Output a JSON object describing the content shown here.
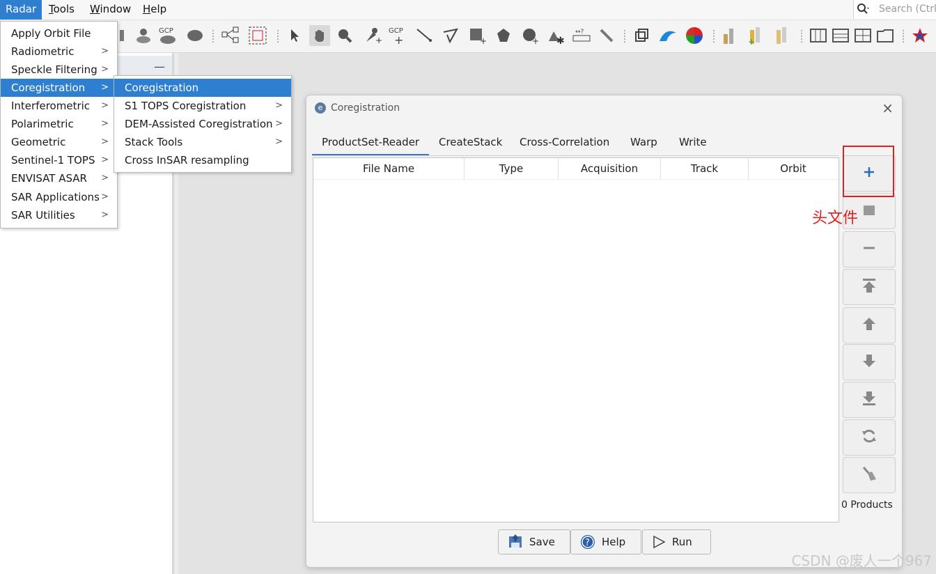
{
  "menubar": {
    "items": [
      {
        "label": "Radar",
        "ul": "",
        "rest": "Radar"
      },
      {
        "label": "Tools",
        "ul": "T",
        "rest": "ools"
      },
      {
        "label": "Window",
        "ul": "W",
        "rest": "indow"
      },
      {
        "label": "Help",
        "ul": "H",
        "rest": "elp"
      }
    ],
    "search_placeholder": "Search (Ctrl+I)"
  },
  "toolbar": {
    "gcp_label": "GCP"
  },
  "radar_menu": {
    "items": [
      {
        "label": "Apply Orbit File",
        "submenu": false
      },
      {
        "label": "Radiometric",
        "submenu": true
      },
      {
        "label": "Speckle Filtering",
        "submenu": true
      },
      {
        "label": "Coregistration",
        "submenu": true
      },
      {
        "label": "Interferometric",
        "submenu": true
      },
      {
        "label": "Polarimetric",
        "submenu": true
      },
      {
        "label": "Geometric",
        "submenu": true
      },
      {
        "label": "Sentinel-1 TOPS",
        "submenu": true
      },
      {
        "label": "ENVISAT ASAR",
        "submenu": true
      },
      {
        "label": "SAR Applications",
        "submenu": true
      },
      {
        "label": "SAR Utilities",
        "submenu": true
      }
    ]
  },
  "coreg_submenu": {
    "items": [
      {
        "label": "Coregistration",
        "submenu": false
      },
      {
        "label": "S1 TOPS Coregistration",
        "submenu": true
      },
      {
        "label": "DEM-Assisted Coregistration",
        "submenu": true
      },
      {
        "label": "Stack Tools",
        "submenu": true
      },
      {
        "label": "Cross InSAR resampling",
        "submenu": false
      }
    ]
  },
  "dialog": {
    "title": "Coregistration",
    "tabs": [
      "ProductSet-Reader",
      "CreateStack",
      "Cross-Correlation",
      "Warp",
      "Write"
    ],
    "columns": [
      "File Name",
      "Type",
      "Acquisition",
      "Track",
      "Orbit"
    ],
    "product_count": "0 Products",
    "buttons": {
      "save": "Save",
      "help": "Help",
      "run": "Run"
    }
  },
  "annotation": {
    "text": "头文件",
    "color": "#e02020"
  },
  "watermark": "CSDN @废人一个967",
  "colors": {
    "accent": "#2f7fd1",
    "tab_underline": "#3a7bd5",
    "annotation_red": "#e02020"
  }
}
